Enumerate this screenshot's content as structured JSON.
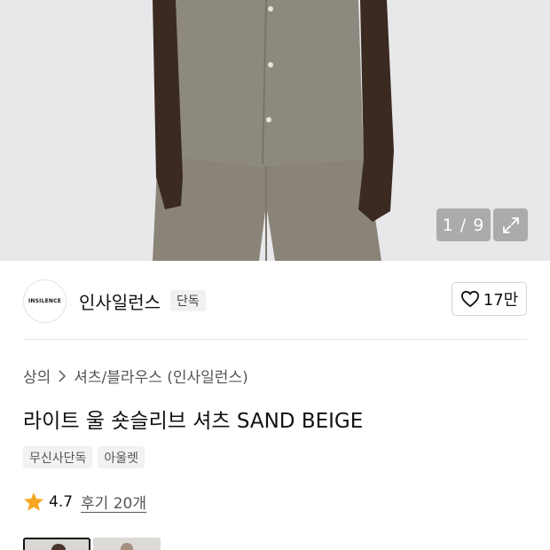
{
  "gallery": {
    "counter": "1 / 9",
    "expand_icon": "expand-icon"
  },
  "brand": {
    "logo_text": "INSILENCE",
    "name": "인사일런스",
    "badge": "단독",
    "like_count": "17만",
    "like_icon": "heart-outline-icon"
  },
  "breadcrumb": {
    "items": [
      "상의",
      "셔츠/블라우스 (인사일런스)"
    ],
    "separator_icon": "chevron-right-icon"
  },
  "product": {
    "title": "라이트 울 숏슬리브 셔츠 SAND BEIGE",
    "tags": [
      "무신사단독",
      "아울렛"
    ]
  },
  "rating": {
    "score": "4.7",
    "reviews": "후기 20개",
    "star_color": "#f5a623"
  },
  "thumbnails": {
    "count": 2,
    "active_index": 0
  }
}
